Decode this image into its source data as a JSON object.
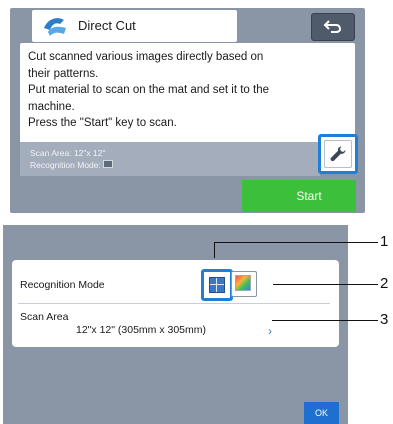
{
  "direct_cut_screen": {
    "title": "Direct Cut",
    "message_lines": [
      "Cut scanned various images directly based on",
      "their patterns.",
      "Put material to scan on the mat and set it to the",
      "machine.",
      "Press the \"Start\" key to scan."
    ],
    "info_scan_area": "Scan Area: 12\"x 12\"",
    "info_recognition_mode": "Recognition Mode:",
    "start_label": "Start",
    "icons": {
      "title": "direct-cut-icon",
      "back": "back-arrow-icon",
      "settings": "wrench-icon"
    }
  },
  "settings_screen": {
    "recognition_mode_label": "Recognition Mode",
    "scan_area_label": "Scan Area",
    "scan_area_value": "12\"x 12\" (305mm x 305mm)",
    "ok_label": "OK",
    "icons": {
      "mode_outline": "outline-mode-icon",
      "mode_color": "color-mode-icon",
      "scan_area_arrow": "chevron-right-icon"
    }
  },
  "callouts": [
    "1",
    "2",
    "3"
  ],
  "colors": {
    "panel_bg": "#8a96a6",
    "highlight_blue": "#1f7fd6",
    "start_green": "#3cbf3a",
    "ok_blue": "#1f6fd0"
  }
}
